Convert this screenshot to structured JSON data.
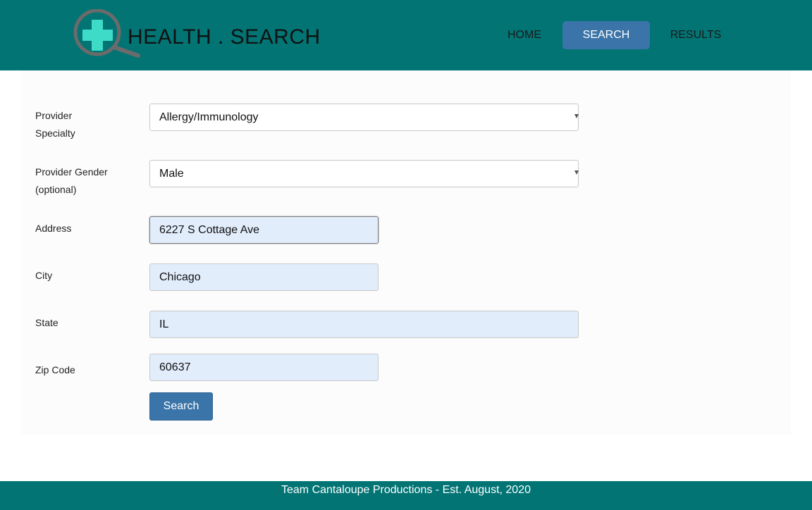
{
  "header": {
    "brand": "HEALTH . SEARCH",
    "logo_icon": "magnifier-medical-cross-icon",
    "colors": {
      "bar": "#027474",
      "active_nav": "#3a74a8",
      "cross": "#3ddbc8"
    }
  },
  "nav": {
    "home": "HOME",
    "search": "SEARCH",
    "results": "RESULTS",
    "active": "SEARCH"
  },
  "form": {
    "specialty": {
      "label_line1": "Provider",
      "label_line2": "Specialty",
      "value": "Allergy/Immunology"
    },
    "gender": {
      "label_line1": "Provider Gender",
      "label_line2": "(optional)",
      "value": "Male"
    },
    "address": {
      "label": "Address",
      "value": "6227 S Cottage Ave"
    },
    "city": {
      "label": "City",
      "value": "Chicago"
    },
    "state": {
      "label": "State",
      "value": "IL"
    },
    "zip": {
      "label": "Zip Code",
      "value": "60637"
    },
    "submit_label": "Search",
    "autofill_color": "#e2edfc"
  },
  "footer": {
    "text": "Team Cantaloupe Productions - Est. August, 2020"
  }
}
